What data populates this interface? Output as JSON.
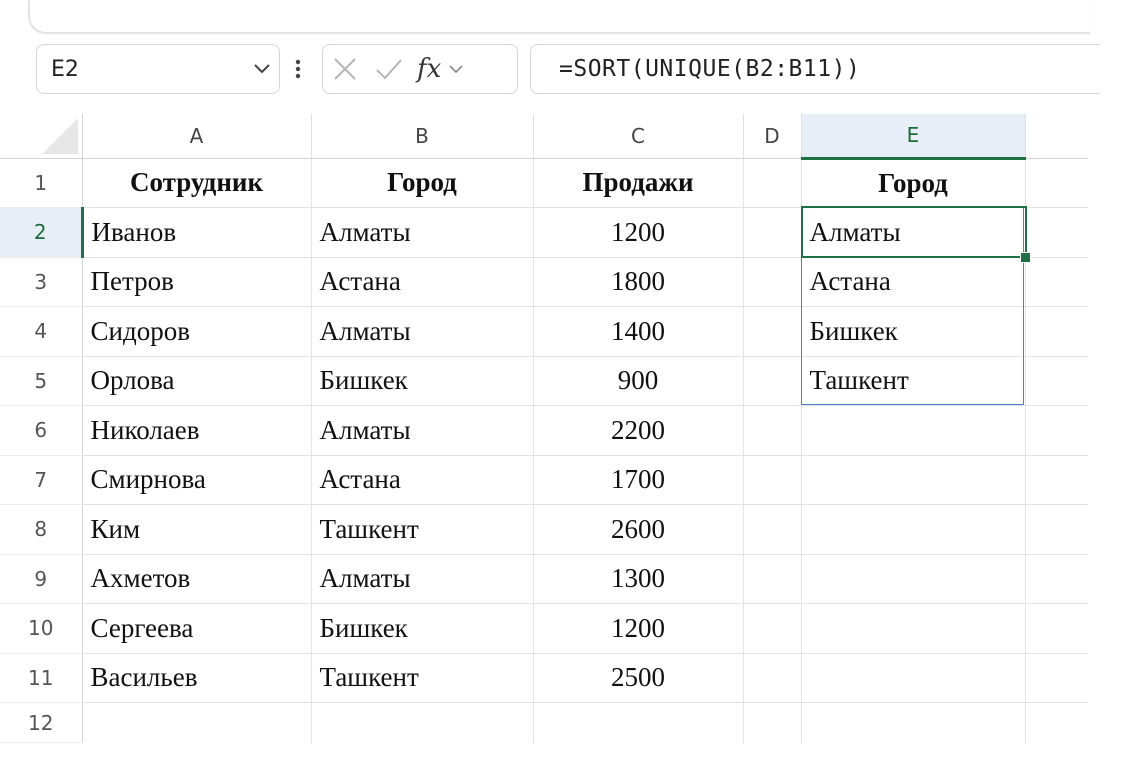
{
  "name_box": {
    "value": "E2"
  },
  "formula_bar": {
    "fx_label": "fx",
    "formula": "=SORT(UNIQUE(B2:B11))"
  },
  "columns": [
    "A",
    "B",
    "C",
    "D",
    "E"
  ],
  "rows": [
    "1",
    "2",
    "3",
    "4",
    "5",
    "6",
    "7",
    "8",
    "9",
    "10",
    "11",
    "12"
  ],
  "cells": [
    [
      "Сотрудник",
      "Город",
      "Продажи",
      "",
      "Город"
    ],
    [
      "Иванов",
      "Алматы",
      "1200",
      "",
      "Алматы"
    ],
    [
      "Петров",
      "Астана",
      "1800",
      "",
      "Астана"
    ],
    [
      "Сидоров",
      "Алматы",
      "1400",
      "",
      "Бишкек"
    ],
    [
      "Орлова",
      "Бишкек",
      "900",
      "",
      "Ташкент"
    ],
    [
      "Николаев",
      "Алматы",
      "2200",
      "",
      ""
    ],
    [
      "Смирнова",
      "Астана",
      "1700",
      "",
      ""
    ],
    [
      "Ким",
      "Ташкент",
      "2600",
      "",
      ""
    ],
    [
      "Ахметов",
      "Алматы",
      "1300",
      "",
      ""
    ],
    [
      "Сергеева",
      "Бишкек",
      "1200",
      "",
      ""
    ],
    [
      "Васильев",
      "Ташкент",
      "2500",
      "",
      ""
    ],
    [
      "",
      "",
      "",
      "",
      ""
    ]
  ],
  "selection": {
    "active_cell": "E2",
    "spill_range": "E2:E5"
  },
  "colors": {
    "accent_green": "#1e7145",
    "spill_border": "#4a7fd0",
    "header_selected_bg": "#e8eef7"
  }
}
